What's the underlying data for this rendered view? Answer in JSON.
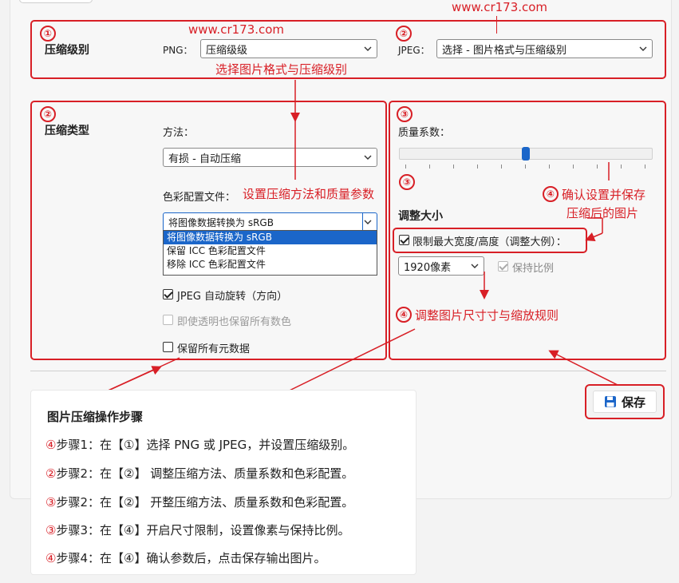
{
  "watermark": {
    "top": "www.cr173.com",
    "left": "www.cr173.com"
  },
  "compression_level": {
    "num": "①",
    "title": "压缩级别",
    "png_label": "PNG：",
    "png_value": "压缩级级",
    "jpeg_num": "②",
    "jpeg_label": "JPEG：",
    "jpeg_value": "选择 - 图片格式与压缩级别",
    "annotation": "选择图片格式与压缩级别"
  },
  "compression_type": {
    "num": "②",
    "title": "压缩类型",
    "method_label": "方法：",
    "method_value": "有损 - 自动压缩",
    "color_label": "色彩配置文件：",
    "color_annotation": "设置压缩方法和质量参数",
    "color_value": "将图像数据转换为 sRGB",
    "color_options": [
      "将图像数据转换为 sRGB",
      "保留 ICC 色彩配置文件",
      "移除 ICC 色彩配置文件"
    ],
    "jpeg_rotate": "JPEG 自动旋转（方向）",
    "keep_transparent": "即使透明也保留所有数色",
    "keep_meta": "保留所有元数据"
  },
  "quality": {
    "num": "③",
    "title": "质量系数：",
    "value_percent": 50,
    "resize_num": "③",
    "resize_title": "调整大小",
    "limit_label": "限制最大宽度/高度（调整大例）：",
    "size_value": "1920像素",
    "keep_ratio": "保持比例",
    "confirm_num": "④",
    "confirm_annotation_1": "确认设置并保存",
    "confirm_annotation_2": "压缩后的图片",
    "resize_annotation_num": "④",
    "resize_annotation": "调整图片尺寸寸与缩放规则"
  },
  "save": {
    "label": "保存"
  },
  "steps": {
    "title": "图片压缩操作步骤",
    "items": [
      {
        "num": "④",
        "text": "步骤1：在【①】选择 PNG 或 JPEG，并设置压缩级别。"
      },
      {
        "num": "②",
        "text": "步骤2：在【②】 调整压缩方法、质量系数和色彩配置。"
      },
      {
        "num": "③",
        "text": "步骤2：在【②】 开整压缩方法、质量系数和色彩配置。"
      },
      {
        "num": "③",
        "text": "步骤3：在【④】开启尺寸限制，设置像素与保持比例。"
      },
      {
        "num": "④",
        "text": "步骤4：在【④】确认参数后，点击保存输出图片。"
      }
    ]
  },
  "colors": {
    "accent": "#d81f26",
    "selection": "#1b66c9"
  }
}
